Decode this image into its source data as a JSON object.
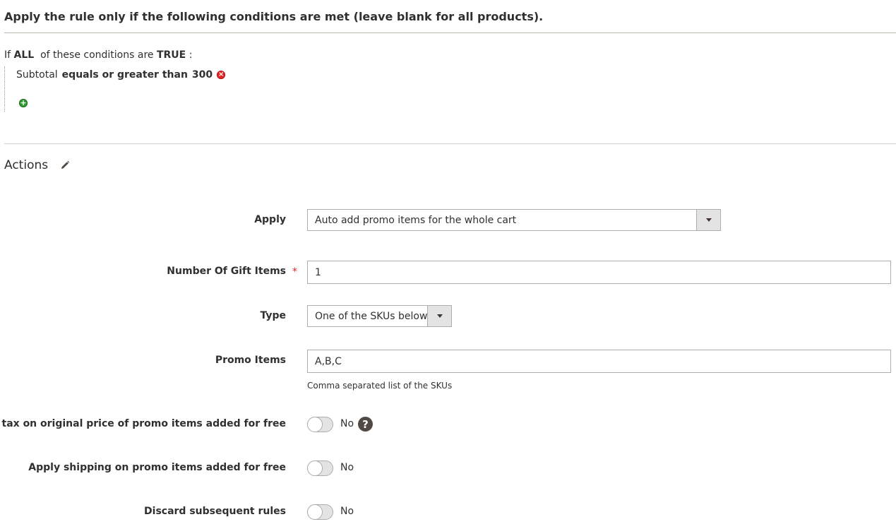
{
  "conditions": {
    "heading": "Apply the rule only if the following conditions are met (leave blank for all products).",
    "if_prefix": "If",
    "aggregator": "ALL",
    "of_text": "of these conditions are",
    "value": "TRUE",
    "colon": ":",
    "rule": {
      "attribute": "Subtotal",
      "operator": "equals or greater than",
      "value": "300"
    },
    "remove_icon": "remove-icon",
    "add_icon": "add-icon"
  },
  "actions": {
    "title": "Actions",
    "edit_icon": "pencil-icon",
    "fields": {
      "apply": {
        "label": "Apply",
        "value": "Auto add promo items for the whole cart"
      },
      "gift_items": {
        "label": "Number Of Gift Items",
        "value": "1",
        "required_mark": "*"
      },
      "type": {
        "label": "Type",
        "value": "One of the SKUs below"
      },
      "promo_items": {
        "label": "Promo Items",
        "value": "A,B,C",
        "note": "Comma separated list of the SKUs"
      },
      "apply_tax": {
        "label": "Apply tax on original price of promo items added for free",
        "value": "No",
        "help": "?"
      },
      "apply_shipping": {
        "label": "Apply shipping on promo items added for free",
        "value": "No"
      },
      "discard_rules": {
        "label": "Discard subsequent rules",
        "value": "No"
      }
    }
  },
  "colors": {
    "required": "#e22626",
    "remove": "#e22626",
    "add": "#2f9a2f",
    "help_bg": "#514943"
  }
}
